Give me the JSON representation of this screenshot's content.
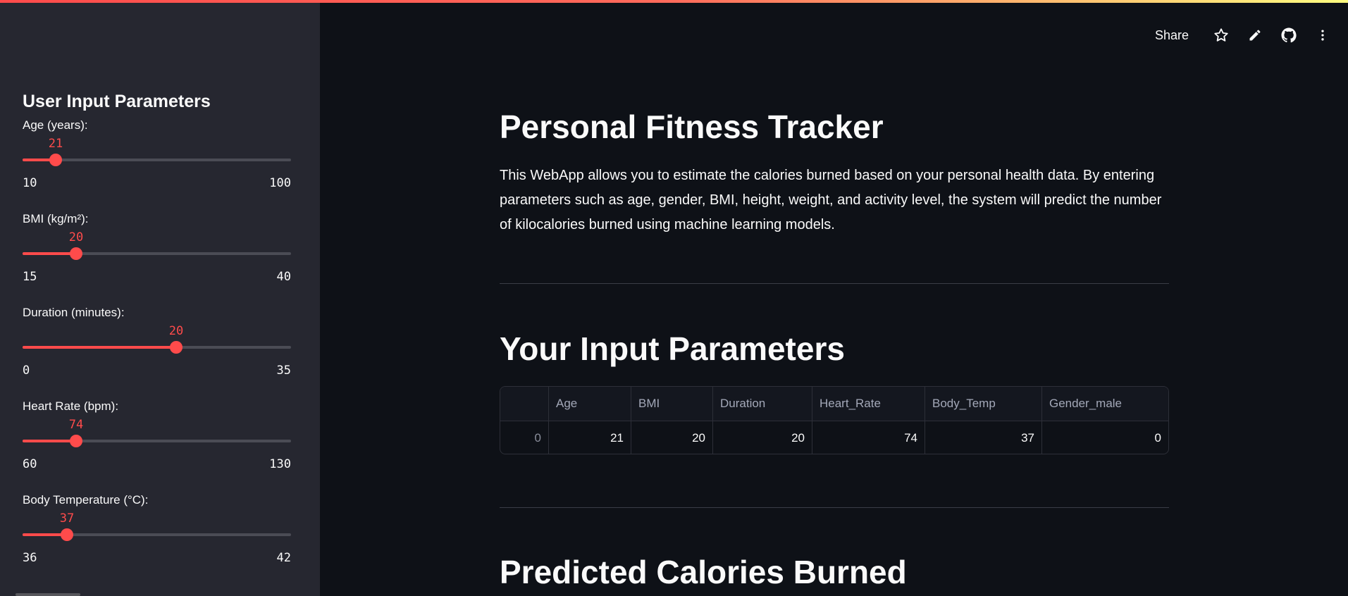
{
  "sidebar": {
    "title": "User Input Parameters",
    "sliders": [
      {
        "label": "Age (years):",
        "value": "21",
        "min": "10",
        "max": "100"
      },
      {
        "label": "BMI (kg/m²):",
        "value": "20",
        "min": "15",
        "max": "40"
      },
      {
        "label": "Duration (minutes):",
        "value": "20",
        "min": "0",
        "max": "35"
      },
      {
        "label": "Heart Rate (bpm):",
        "value": "74",
        "min": "60",
        "max": "130"
      },
      {
        "label": "Body Temperature (°C):",
        "value": "37",
        "min": "36",
        "max": "42"
      }
    ]
  },
  "toolbar": {
    "share_label": "Share",
    "icons": [
      "star-icon",
      "edit-pencil-icon",
      "github-icon",
      "more-vertical-icon"
    ]
  },
  "main": {
    "title": "Personal Fitness Tracker",
    "description": "This WebApp allows you to estimate the calories burned based on your personal health data. By entering parameters such as age, gender, BMI, height, weight, and activity level, the system will predict the number of kilocalories burned using machine learning models.",
    "input_heading": "Your Input Parameters",
    "table": {
      "columns": [
        "",
        "Age",
        "BMI",
        "Duration",
        "Heart_Rate",
        "Body_Temp",
        "Gender_male"
      ],
      "rows": [
        [
          "0",
          "21",
          "20",
          "20",
          "74",
          "37",
          "0"
        ]
      ]
    },
    "prediction_heading": "Predicted Calories Burned"
  },
  "colors": {
    "accent": "#ff4b4b",
    "background": "#0e1117",
    "sidebar_bg": "#262730",
    "text": "#fafafa"
  }
}
